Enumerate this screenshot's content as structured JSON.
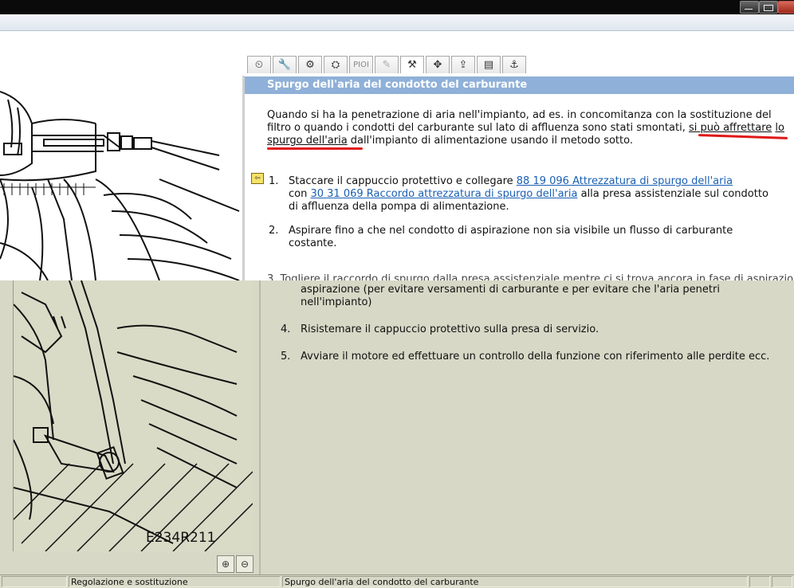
{
  "window": {
    "accent": "#8fb0d8"
  },
  "toolbar": {
    "tabs": [
      {
        "icon": "gauge-icon"
      },
      {
        "icon": "wrench-icon"
      },
      {
        "icon": "gears-icon"
      },
      {
        "icon": "engine-icon"
      },
      {
        "icon": "pi-oi-text",
        "label": "PIOI"
      },
      {
        "icon": "pencil-icon"
      },
      {
        "icon": "tools-icon"
      },
      {
        "icon": "move-icon"
      },
      {
        "icon": "lift-icon"
      },
      {
        "icon": "document-icon"
      },
      {
        "icon": "hook-icon"
      }
    ]
  },
  "section": {
    "title": "Spurgo dell'aria del condotto del carburante",
    "intro_a": "Quando si ha la penetrazione di aria nell'impianto, ad es. in concomitanza con la sostituzione del filtro o quando i condotti del carburante sul lato di affluenza sono stati smontati, ",
    "intro_u1": "si può affrettare",
    "intro_b": " ",
    "intro_u2": "lo spurgo dell'aria",
    "intro_c": " dall'impianto di alimentazione usando il metodo sotto."
  },
  "steps": [
    {
      "num": "1.",
      "text_a": "Staccare il cappuccio protettivo e collegare ",
      "link_a": "88 19 096 Attrezzatura di spurgo dell'aria",
      "text_b": " con ",
      "link_b": "30 31 069 Raccordo attrezzatura di spurgo dell'aria",
      "text_c": " alla presa assistenziale sul condotto di affluenza della pompa di alimentazione."
    },
    {
      "num": "2.",
      "text": "Aspirare fino a che nel condotto di aspirazione non sia visibile un flusso di carburante costante."
    },
    {
      "num": "3.",
      "text": "Togliere il raccordo di spurgo dalla presa assistenziale mentre ci si trova ancora in fase di aspirazione (per evitare versamenti di carburante e per evitare che l'aria penetri nell'impianto)",
      "text_visible": "aspirazione (per evitare versamenti di carburante e per evitare che l'aria penetri nell'impianto)"
    },
    {
      "num": "4.",
      "text": "Risistemare il cappuccio protettivo sulla presa di servizio."
    },
    {
      "num": "5.",
      "text": "Avviare il motore ed effettuare un controllo della funzione con riferimento alle perdite ecc."
    }
  ],
  "image": {
    "caption": "E234R211"
  },
  "zoom": {
    "in_icon": "zoom-in-icon",
    "out_icon": "zoom-out-icon"
  },
  "status": {
    "left": "",
    "middle": "Regolazione e sostituzione",
    "right": "Spurgo dell'aria del condotto del carburante"
  }
}
